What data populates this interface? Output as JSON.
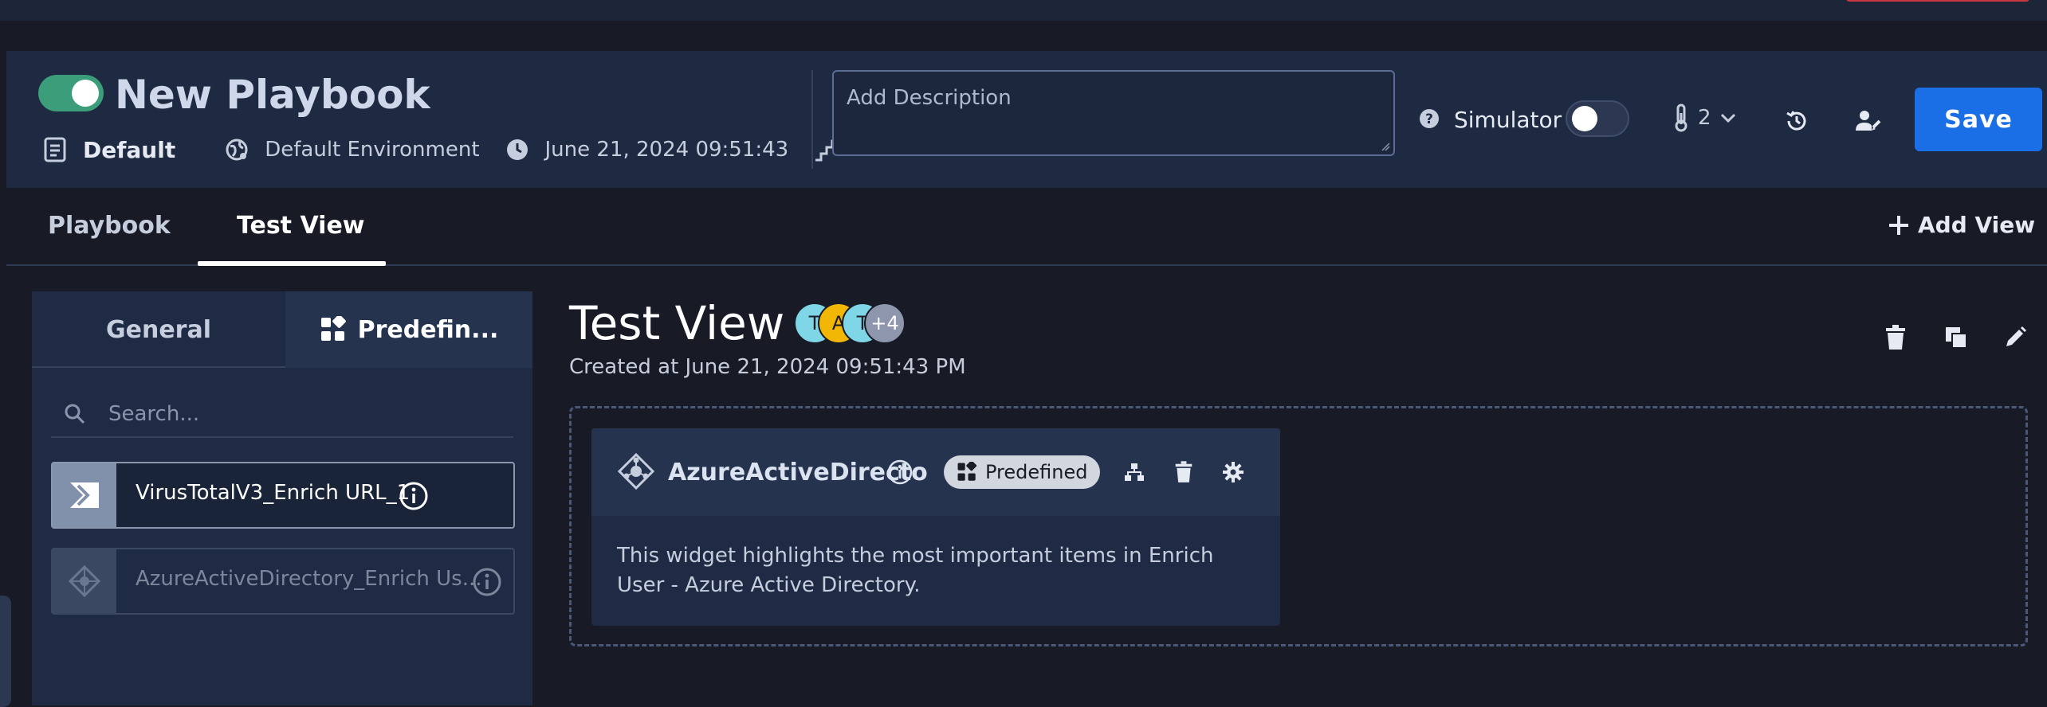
{
  "header": {
    "playbook_enabled": true,
    "title": "New Playbook",
    "meta": {
      "category": "Default",
      "environment": "Default Environment",
      "timestamp": "June 21, 2024 09:51:43",
      "steps": "2"
    },
    "description_placeholder": "Add Description",
    "simulator_label": "Simulator",
    "simulator_enabled": false,
    "priority_value": "2",
    "save_label": "Save"
  },
  "tabs": [
    {
      "label": "Playbook",
      "active": false
    },
    {
      "label": "Test View",
      "active": true
    }
  ],
  "add_view_label": "Add View",
  "left_panel": {
    "tab_general": "General",
    "tab_predefined": "Predefin...",
    "search_placeholder": "Search...",
    "items": [
      {
        "label": "VirusTotalV3_Enrich URL_1",
        "enabled": true,
        "icon": "virustotal-icon"
      },
      {
        "label": "AzureActiveDirectory_Enrich Us...",
        "enabled": false,
        "icon": "azure-ad-icon"
      }
    ]
  },
  "view": {
    "title": "Test View",
    "created": "Created at June 21, 2024 09:51:43 PM",
    "avatars": [
      {
        "initial": "T",
        "color": "#7ed6e6"
      },
      {
        "initial": "A",
        "color": "#f2b705"
      },
      {
        "initial": "T",
        "color": "#7ed6e6"
      },
      {
        "initial": "+4",
        "color": "#8e96ad"
      }
    ]
  },
  "widget": {
    "name": "AzureActiveDirecto",
    "badge": "Predefined",
    "description": "This widget highlights the most important items in Enrich User - Azure Active Directory."
  },
  "colors": {
    "accent": "#1a6ee6",
    "toggle_on": "#3b9d7a",
    "header_bg": "#1e2a42",
    "page_bg": "#181a26"
  }
}
